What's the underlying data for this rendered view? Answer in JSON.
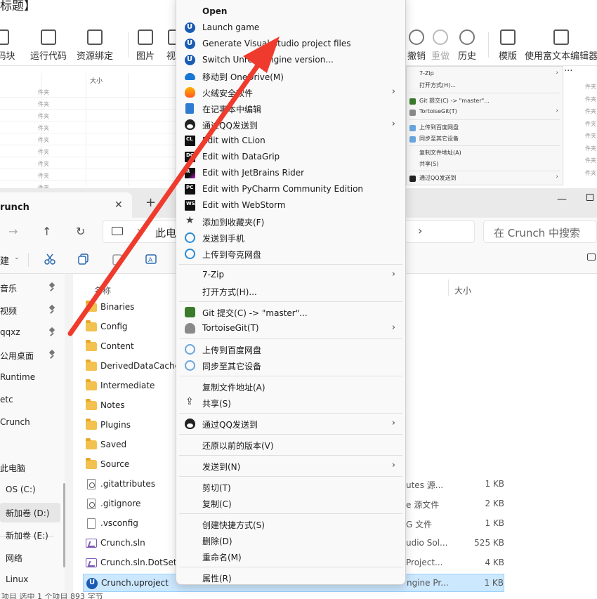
{
  "editor": {
    "title_fragment": "标题】",
    "toolbar": [
      {
        "label": "代码块",
        "icon": "code-block-icon",
        "disabled": false
      },
      {
        "label": "运行代码",
        "icon": "run-code-icon",
        "disabled": false
      },
      {
        "label": "资源绑定",
        "icon": "resource-bind-icon",
        "disabled": false
      },
      {
        "label": "图片",
        "icon": "image-icon",
        "disabled": false
      },
      {
        "label": "视频",
        "icon": "video-icon",
        "disabled": false
      },
      {
        "label": "撤销",
        "icon": "undo-icon",
        "disabled": false
      },
      {
        "label": "重做",
        "icon": "redo-icon",
        "disabled": true
      },
      {
        "label": "历史",
        "icon": "history-icon",
        "disabled": false
      },
      {
        "label": "模版",
        "icon": "template-icon",
        "disabled": false
      },
      {
        "label": "使用富文本编辑器",
        "icon": "swap-editor-icon",
        "disabled": false
      }
    ],
    "table_header_size": "大小",
    "table_cell_text": "件夹",
    "mini_menu": [
      {
        "label": "7-Zip",
        "submenu": true
      },
      {
        "label": "打开方式(H)...",
        "submenu": false
      },
      {
        "label": "Git 提交(C) -> \"master\"...",
        "submenu": false
      },
      {
        "label": "TortoiseGit(T)",
        "submenu": true
      },
      {
        "label": "上传到百度网盘",
        "submenu": false
      },
      {
        "label": "同步至其它设备",
        "submenu": false
      },
      {
        "label": "复制文件地址(A)",
        "submenu": false
      },
      {
        "label": "共享(S)",
        "submenu": false
      },
      {
        "label": "通过QQ发送到",
        "submenu": true
      }
    ],
    "more": "···"
  },
  "explorer": {
    "tab_title": "runch",
    "tab_close": "✕",
    "tab_add": "+",
    "addr_path": "此电",
    "search_placeholder": "在 Crunch 中搜索",
    "new_label": "建",
    "nav_items": [
      {
        "label": "音乐",
        "pinned": true
      },
      {
        "label": "视频",
        "pinned": true
      },
      {
        "label": "qqxz",
        "pinned": true
      },
      {
        "label": "公用桌面",
        "pinned": true
      },
      {
        "label": "Runtime",
        "pinned": false
      },
      {
        "label": "etc",
        "pinned": false
      },
      {
        "label": "Crunch",
        "pinned": false
      },
      {
        "label": "此电脑",
        "pinned": false
      },
      {
        "label": "OS (C:)",
        "pinned": false
      },
      {
        "label": "新加卷 (D:)",
        "pinned": false,
        "active": true
      },
      {
        "label": "新加卷 (E:)",
        "pinned": false
      },
      {
        "label": "网络",
        "pinned": false
      },
      {
        "label": "Linux",
        "pinned": false
      }
    ],
    "col_name": "名称",
    "col_size": "大小",
    "files": [
      {
        "name": "Binaries",
        "kind": "folder",
        "type": "",
        "size": ""
      },
      {
        "name": "Config",
        "kind": "folder",
        "type": "",
        "size": ""
      },
      {
        "name": "Content",
        "kind": "folder",
        "type": "",
        "size": ""
      },
      {
        "name": "DerivedDataCache",
        "kind": "folder",
        "type": "",
        "size": ""
      },
      {
        "name": "Intermediate",
        "kind": "folder",
        "type": "",
        "size": ""
      },
      {
        "name": "Notes",
        "kind": "folder",
        "type": "",
        "size": ""
      },
      {
        "name": "Plugins",
        "kind": "folder",
        "type": "",
        "size": ""
      },
      {
        "name": "Saved",
        "kind": "folder",
        "type": "",
        "size": ""
      },
      {
        "name": "Source",
        "kind": "folder",
        "type": "",
        "size": ""
      },
      {
        "name": ".gitattributes",
        "kind": "gear",
        "type": "utes 源...",
        "size": "1 KB"
      },
      {
        "name": ".gitignore",
        "kind": "gear",
        "type": "e 源文件",
        "size": "2 KB"
      },
      {
        "name": ".vsconfig",
        "kind": "doc",
        "type": "G 文件",
        "size": "1 KB"
      },
      {
        "name": "Crunch.sln",
        "kind": "vs",
        "type": "udio Sol...",
        "size": "525 KB"
      },
      {
        "name": "Crunch.sln.DotSetti",
        "kind": "vs",
        "type": "Project...",
        "size": "4 KB"
      },
      {
        "name": "Crunch.uproject",
        "kind": "ue",
        "type": "ngine Pr...",
        "size": "1 KB",
        "selected": true
      }
    ],
    "status_text": "项目    选中 1 个项目  893 字节"
  },
  "context_menu": {
    "items": [
      {
        "label": "Open",
        "bold": true,
        "icon": "",
        "submenu": false
      },
      {
        "label": "Launch game",
        "icon": "unreal-icon",
        "submenu": false
      },
      {
        "label": "Generate Visual Studio project files",
        "icon": "unreal-icon",
        "submenu": false
      },
      {
        "label": "Switch Unreal Engine version...",
        "icon": "unreal-icon",
        "submenu": false
      },
      {
        "label": "移动到 OneDrive(M)",
        "icon": "onedrive-icon",
        "submenu": false
      },
      {
        "label": "火绒安全软件",
        "icon": "huorong-icon",
        "submenu": true
      },
      {
        "label": "在记事本中编辑",
        "icon": "notepad-icon",
        "submenu": false
      },
      {
        "label": "通过QQ发送到",
        "icon": "qq-icon",
        "submenu": true
      },
      {
        "label": "Edit with CLion",
        "icon": "clion-icon",
        "submenu": false
      },
      {
        "label": "Edit with DataGrip",
        "icon": "datagrip-icon",
        "submenu": false
      },
      {
        "label": "Edit with JetBrains Rider",
        "icon": "rider-icon",
        "submenu": false
      },
      {
        "label": "Edit with PyCharm Community Edition",
        "icon": "pycharm-icon",
        "submenu": false
      },
      {
        "label": "Edit with WebStorm",
        "icon": "webstorm-icon",
        "submenu": false
      },
      {
        "label": "添加到收藏夹(F)",
        "icon": "star-icon",
        "submenu": false
      },
      {
        "label": "发送到手机",
        "icon": "quark-icon",
        "submenu": false
      },
      {
        "label": "上传到夸克网盘",
        "icon": "quark-icon",
        "submenu": false
      },
      {
        "sep": true
      },
      {
        "label": "7-Zip",
        "icon": "",
        "submenu": true
      },
      {
        "label": "打开方式(H)...",
        "icon": "",
        "submenu": false
      },
      {
        "sep": true
      },
      {
        "label": "Git 提交(C) -> \"master\"...",
        "icon": "git-commit-icon",
        "submenu": false
      },
      {
        "label": "TortoiseGit(T)",
        "icon": "tortoisegit-icon",
        "submenu": true
      },
      {
        "sep": true
      },
      {
        "label": "上传到百度网盘",
        "icon": "baidu-netdisk-icon",
        "submenu": false
      },
      {
        "label": "同步至其它设备",
        "icon": "baidu-netdisk-icon",
        "submenu": false
      },
      {
        "sep": true
      },
      {
        "label": "复制文件地址(A)",
        "icon": "",
        "submenu": false
      },
      {
        "label": "共享(S)",
        "icon": "share-icon",
        "submenu": false
      },
      {
        "sep": true
      },
      {
        "label": "通过QQ发送到",
        "icon": "qq-icon",
        "submenu": true
      },
      {
        "sep": true
      },
      {
        "label": "还原以前的版本(V)",
        "icon": "",
        "submenu": false
      },
      {
        "sep": true
      },
      {
        "label": "发送到(N)",
        "icon": "",
        "submenu": true
      },
      {
        "sep": true
      },
      {
        "label": "剪切(T)",
        "icon": "",
        "submenu": false
      },
      {
        "label": "复制(C)",
        "icon": "",
        "submenu": false
      },
      {
        "sep": true
      },
      {
        "label": "创建快捷方式(S)",
        "icon": "",
        "submenu": false
      },
      {
        "label": "删除(D)",
        "icon": "",
        "submenu": false
      },
      {
        "label": "重命名(M)",
        "icon": "",
        "submenu": false
      },
      {
        "sep": true
      },
      {
        "label": "属性(R)",
        "icon": "",
        "submenu": false
      }
    ],
    "submenu_glyph": "›"
  },
  "colors": {
    "arrow": "#ef3b2d",
    "selection": "#cce8ff",
    "accent": "#1a5bb5"
  }
}
